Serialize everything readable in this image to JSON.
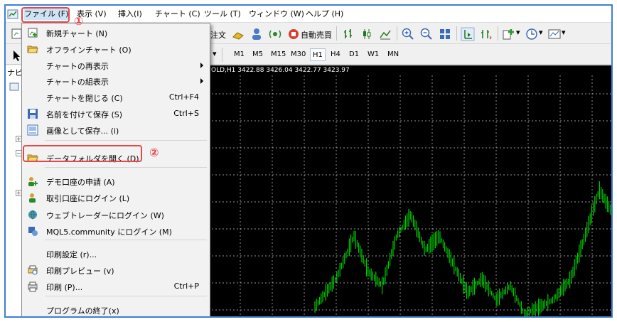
{
  "menubar": {
    "items": [
      "ファイル (F)",
      "表示 (V)",
      "挿入(I)",
      "チャート (C)",
      "ツール (T)",
      "ウィンドウ (W)",
      "ヘルプ (H)"
    ]
  },
  "annotations": {
    "step1": "①",
    "step2": "②"
  },
  "toolbar": {
    "order_label": "注文",
    "autotrade_label": "自動売買",
    "timeframes": [
      "M1",
      "M5",
      "M15",
      "M30",
      "H1",
      "H4",
      "D1",
      "W1",
      "MN"
    ],
    "active_timeframe": "H1"
  },
  "navigator": {
    "title": "ナビ"
  },
  "chart": {
    "symbol_prefix": "OLD,H1",
    "ohlc": [
      "3422.88",
      "3426.04",
      "3422.77",
      "3423.97"
    ],
    "candle_color": "#00c800",
    "grid_color": "#c8c8c8",
    "background": "#000000"
  },
  "file_menu": {
    "items": [
      {
        "label": "新規チャート (N)",
        "icon": "new-chart-icon",
        "shortcut": "",
        "submenu": false,
        "disabled": false
      },
      {
        "label": "オフラインチャート (O)",
        "icon": "folder-open-icon",
        "shortcut": "",
        "submenu": false,
        "disabled": false
      },
      {
        "label": "チャートの再表示",
        "icon": "",
        "shortcut": "",
        "submenu": true,
        "disabled": false
      },
      {
        "label": "チャートの組表示",
        "icon": "",
        "shortcut": "",
        "submenu": true,
        "disabled": false
      },
      {
        "label": "チャートを閉じる (C)",
        "icon": "",
        "shortcut": "Ctrl+F4",
        "submenu": false,
        "disabled": false
      },
      {
        "label": "名前を付けて保存 (S)",
        "icon": "save-icon",
        "shortcut": "Ctrl+S",
        "submenu": false,
        "disabled": false
      },
      {
        "label": "画像として保存... (i)",
        "icon": "save-image-icon",
        "shortcut": "",
        "submenu": false,
        "disabled": false
      },
      {
        "label": "データフォルダを開く (D)",
        "icon": "folder-icon",
        "shortcut": "",
        "submenu": false,
        "disabled": false
      },
      {
        "label": "デモ口座の申請 (A)",
        "icon": "demo-account-icon",
        "shortcut": "",
        "submenu": false,
        "disabled": false
      },
      {
        "label": "取引口座にログイン (L)",
        "icon": "login-icon",
        "shortcut": "",
        "submenu": false,
        "disabled": false
      },
      {
        "label": "ウェブトレーダーにログイン (W)",
        "icon": "web-trader-icon",
        "shortcut": "",
        "submenu": false,
        "disabled": false
      },
      {
        "label": "MQL5.community にログイン (M)",
        "icon": "mql5-icon",
        "shortcut": "",
        "submenu": false,
        "disabled": false
      },
      {
        "label": "印刷設定 (r)...",
        "icon": "",
        "shortcut": "",
        "submenu": false,
        "disabled": false
      },
      {
        "label": "印刷プレビュー (v)",
        "icon": "print-preview-icon",
        "shortcut": "",
        "submenu": false,
        "disabled": false
      },
      {
        "label": "印刷 (P)...",
        "icon": "print-icon",
        "shortcut": "Ctrl+P",
        "submenu": false,
        "disabled": false
      },
      {
        "label": "プログラムの終了(x)",
        "icon": "",
        "shortcut": "",
        "submenu": false,
        "disabled": false
      }
    ]
  }
}
